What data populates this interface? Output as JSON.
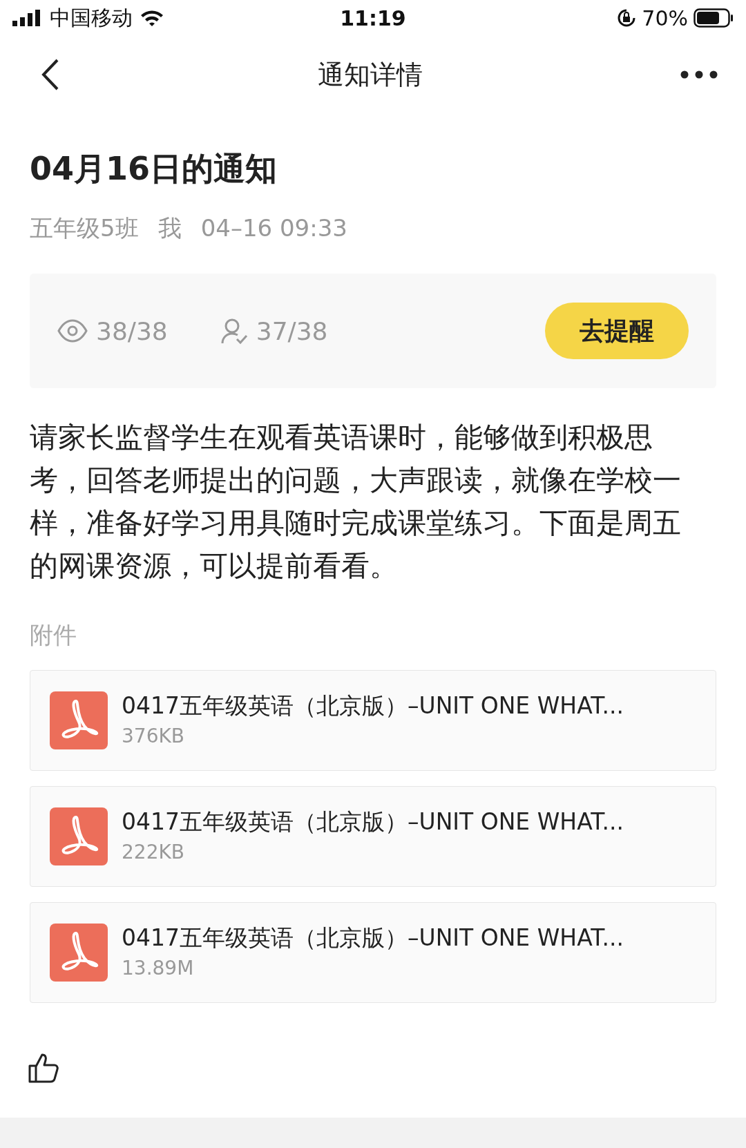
{
  "status_bar": {
    "carrier": "中国移动",
    "time": "11:19",
    "battery_percent": "70%"
  },
  "nav": {
    "title": "通知详情"
  },
  "notice": {
    "title": "04月16日的通知",
    "class_name": "五年级5班",
    "sender": "我",
    "datetime": "04–16 09:33"
  },
  "stats": {
    "read": "38/38",
    "confirmed": "37/38",
    "remind_button": "去提醒"
  },
  "body": "请家长监督学生在观看英语课时，能够做到积极思考，回答老师提出的问题，大声跟读，就像在学校一样，准备好学习用具随时完成课堂练习。下面是周五的网课资源，可以提前看看。",
  "attachments_label": "附件",
  "attachments": [
    {
      "name": "0417五年级英语（北京版）–UNIT ONE WHAT...",
      "size": "376KB"
    },
    {
      "name": "0417五年级英语（北京版）–UNIT ONE WHAT...",
      "size": "222KB"
    },
    {
      "name": "0417五年级英语（北京版）–UNIT ONE WHAT...",
      "size": "13.89M"
    }
  ]
}
